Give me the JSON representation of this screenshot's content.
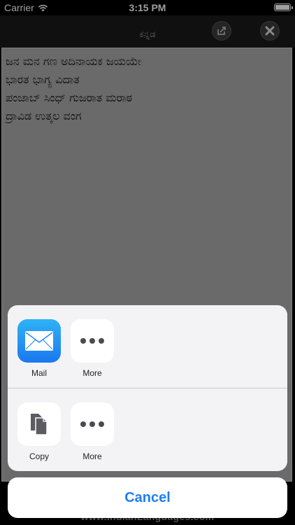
{
  "status_bar": {
    "carrier": "Carrier",
    "time": "3:15 PM"
  },
  "nav": {
    "title": "ಕನ್ನಡ",
    "share_icon": "share-icon",
    "close_icon": "close-icon"
  },
  "editor": {
    "lines": [
      "ಜನ ಮನ ಗಣ ಅದಿನಾಯಕ ಜಯಯೇ",
      "ಭಾರತ ಭಾಗ್ಯ ವಿದಾತ",
      "ಪಂಜಾಬ್ ಸಿಂಧ್ ಗುಜರಾತ ಮರಾಠ",
      "ದ್ರಾವಿಡ ಉತ್ಕಲ ವಂಗ"
    ]
  },
  "footer": {
    "url": "www.IndianLanguages.com"
  },
  "share_sheet": {
    "share_row": [
      {
        "label": "Mail",
        "icon": "mail-icon"
      },
      {
        "label": "More",
        "icon": "more-icon"
      }
    ],
    "action_row": [
      {
        "label": "Copy",
        "icon": "copy-icon"
      },
      {
        "label": "More",
        "icon": "more-icon"
      }
    ],
    "cancel_label": "Cancel"
  },
  "colors": {
    "accent": "#1e7ef5",
    "mail_top": "#2fb2f7",
    "mail_bottom": "#1a78f0",
    "editor_bg": "#ababab"
  }
}
